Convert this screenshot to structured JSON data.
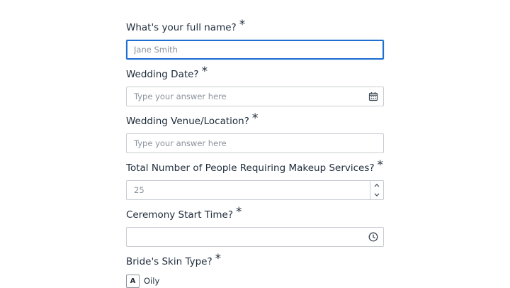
{
  "form": {
    "questions": [
      {
        "label": "What's your full name?",
        "required_mark": "*",
        "placeholder": "Jane Smith",
        "value": ""
      },
      {
        "label": "Wedding Date?",
        "required_mark": "*",
        "placeholder": "Type your answer here",
        "value": "",
        "icon": "calendar-icon"
      },
      {
        "label": "Wedding Venue/Location?",
        "required_mark": "*",
        "placeholder": "Type your answer here",
        "value": ""
      },
      {
        "label": "Total Number of People Requiring Makeup Services?",
        "required_mark": "*",
        "placeholder": "25",
        "value": "",
        "icon": "stepper-icons"
      },
      {
        "label": "Ceremony Start Time?",
        "required_mark": "*",
        "placeholder": "",
        "value": "",
        "icon": "clock-icon"
      },
      {
        "label": "Bride's Skin Type?",
        "required_mark": "*",
        "options": [
          {
            "key": "A",
            "label": "Oily"
          }
        ]
      }
    ]
  },
  "colors": {
    "focus_border": "#1f6fd1",
    "border": "#c9cdd2",
    "text": "#1d2b3a",
    "placeholder": "#8a929b"
  }
}
